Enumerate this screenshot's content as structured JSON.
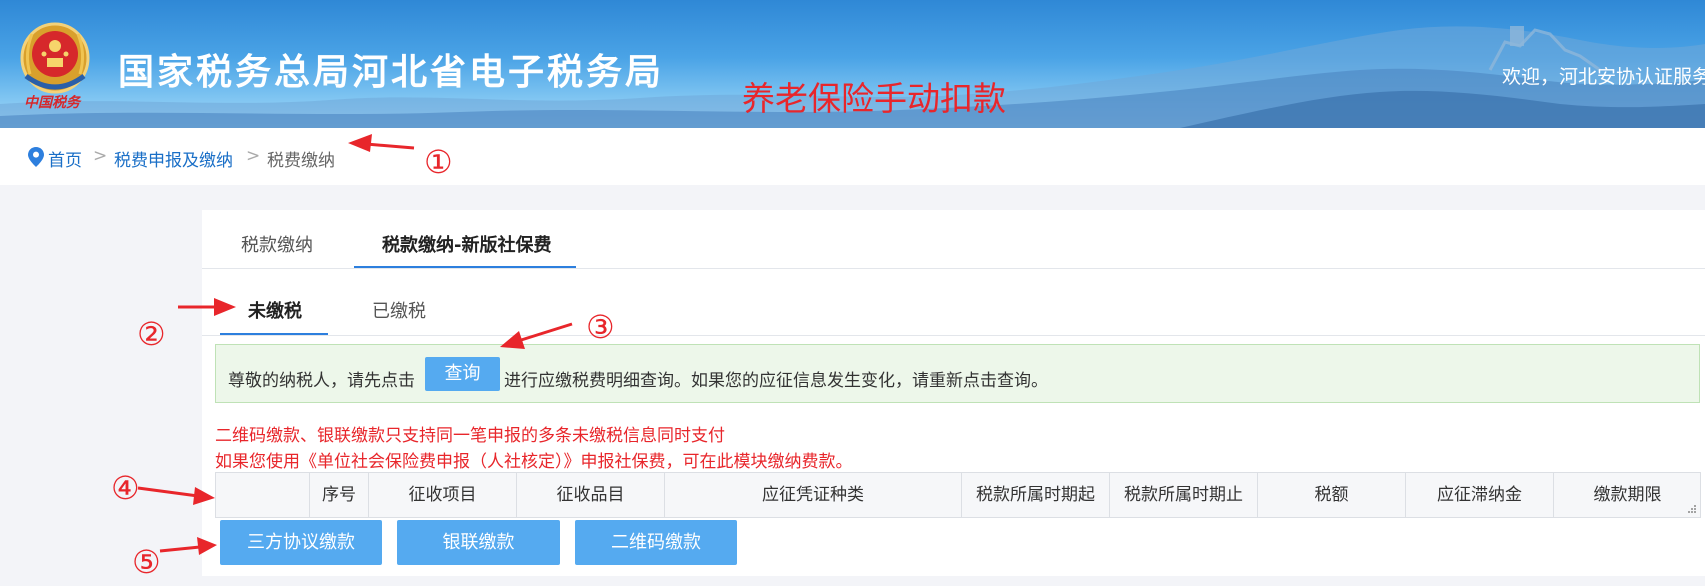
{
  "header": {
    "site_title": "国家税务总局河北省电子税务局",
    "emblem_text": "中国税务",
    "overlay_title": "养老保险手动扣款",
    "welcome_text": "欢迎，河北安协认证服务"
  },
  "breadcrumb": {
    "home": "首页",
    "sep1": ">",
    "level2": "税费申报及缴纳",
    "sep2": ">",
    "current": "税费缴纳"
  },
  "tabs": {
    "main": [
      "税款缴纳",
      "税款缴纳-新版社保费"
    ],
    "sub": [
      "未缴税",
      "已缴税"
    ]
  },
  "notice": {
    "prefix": "尊敬的纳税人，请先点击",
    "query_button": "查询",
    "suffix": "进行应缴税费明细查询。如果您的应征信息发生变化，请重新点击查询。"
  },
  "warnings": [
    "二维码缴款、银联缴款只支持同一笔申报的多条未缴税信息同时支付",
    "如果您使用《单位社会保险费申报（人社核定）》申报社保费，可在此模块缴纳费款。"
  ],
  "table": {
    "columns": [
      "",
      "序号",
      "征收项目",
      "征收品目",
      "应征凭证种类",
      "税款所属时期起",
      "税款所属时期止",
      "税额",
      "应征滞纳金",
      "缴款期限"
    ]
  },
  "actions": {
    "tripartite": "三方协议缴款",
    "unionpay": "银联缴款",
    "qrcode": "二维码缴款"
  },
  "annotations": [
    "①",
    "②",
    "③",
    "④",
    "⑤"
  ],
  "colors": {
    "accent": "#2d7fde",
    "button": "#55aaf0",
    "annotation": "#e8262b",
    "notice_bg": "#edf7ea"
  }
}
